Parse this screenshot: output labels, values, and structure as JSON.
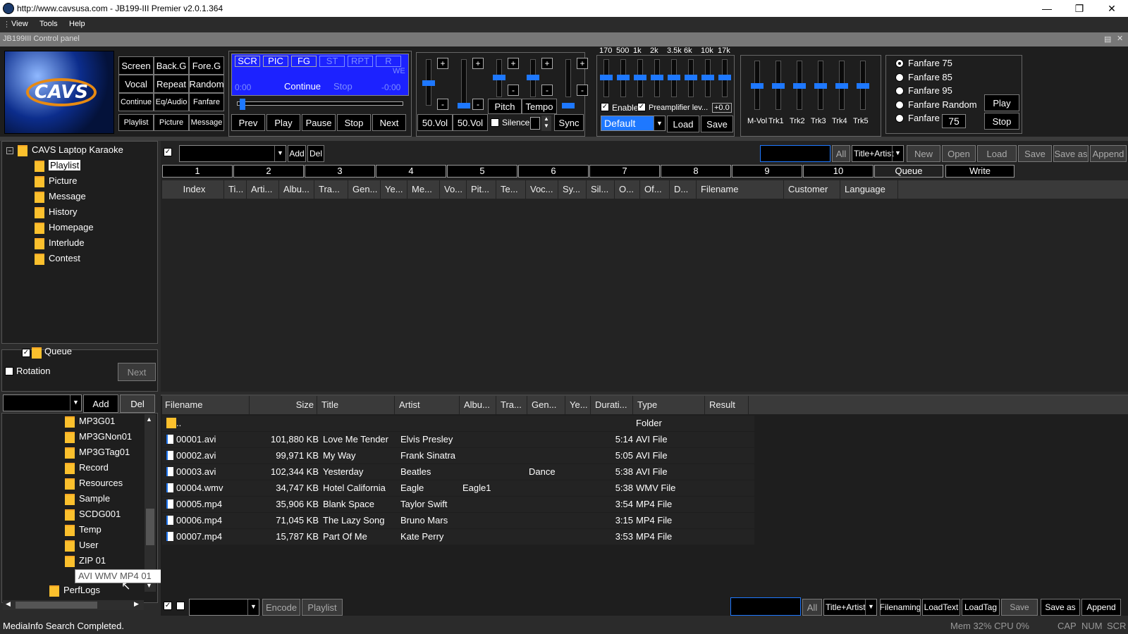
{
  "window": {
    "title": "http://www.cavsusa.com - JB199-III Premier v2.0.1.364"
  },
  "menu": {
    "view": "View",
    "tools": "Tools",
    "help": "Help"
  },
  "control_panel": {
    "title": "JB199III Control panel"
  },
  "logo": {
    "text": "CAVS"
  },
  "grid_buttons": [
    "Screen",
    "Back.G",
    "Fore.G",
    "Vocal",
    "Repeat",
    "Random",
    "Continue",
    "Eq/Audio",
    "Fanfare",
    "Playlist",
    "Picture",
    "Message"
  ],
  "player": {
    "tags": [
      "SCR",
      "PIC",
      "FG",
      "ST",
      "RPT",
      "R"
    ],
    "time_left": "0:00",
    "mode": "Continue",
    "stop_label": "Stop",
    "time_right": "-0:00",
    "we": "WE",
    "buttons": [
      "Prev",
      "Play",
      "Pause",
      "Stop",
      "Next"
    ]
  },
  "mixer": {
    "vol1": "50.Vol",
    "vol2": "50.Vol",
    "pitch": "Pitch",
    "tempo": "Tempo",
    "silence": "Silence",
    "sync": "Sync",
    "plus": "+",
    "minus": "-"
  },
  "eq": {
    "bands": [
      "170",
      "500",
      "1k",
      "2k",
      "3.5k",
      "6k",
      "10k",
      "17k"
    ],
    "enable": "Enable",
    "preamp": "Preamplifier lev...",
    "preamp_value": "+0.0",
    "preset": "Default",
    "load": "Load",
    "save": "Save"
  },
  "tracks": {
    "labels": [
      "M-Vol",
      "Trk1",
      "Trk2",
      "Trk3",
      "Trk4",
      "Trk5"
    ]
  },
  "fanfare": {
    "options": [
      "Fanfare 75",
      "Fanfare 85",
      "Fanfare 95",
      "Fanfare Random",
      "Fanfare"
    ],
    "value": "75",
    "play": "Play",
    "stop": "Stop"
  },
  "tree": {
    "root": "CAVS Laptop Karaoke",
    "items": [
      "Playlist",
      "Picture",
      "Message",
      "History",
      "Homepage",
      "Interlude",
      "Contest"
    ]
  },
  "queue": {
    "label": "Queue",
    "rotation": "Rotation",
    "next": "Next",
    "add": "Add",
    "del": "Del"
  },
  "folders": [
    "MP3G01",
    "MP3GNon01",
    "MP3GTag01",
    "Record",
    "Resources",
    "Sample",
    "SCDG001",
    "Temp",
    "User",
    "ZIP 01"
  ],
  "tooltip": "AVI WMV MP4 01",
  "perflogs": "PerfLogs",
  "playlist_toolbar": {
    "add": "Add",
    "del": "Del",
    "all": "All",
    "field": "Title+Artist",
    "new": "New",
    "open": "Open",
    "load": "Load",
    "save": "Save",
    "save_as": "Save as",
    "append": "Append"
  },
  "num_tabs": [
    "1",
    "2",
    "3",
    "4",
    "5",
    "6",
    "7",
    "8",
    "9",
    "10",
    "Queue",
    "Write"
  ],
  "playlist_columns": [
    "Index",
    "Ti...",
    "Arti...",
    "Albu...",
    "Tra...",
    "Gen...",
    "Ye...",
    "Me...",
    "Vo...",
    "Pit...",
    "Te...",
    "Voc...",
    "Sy...",
    "Sil...",
    "O...",
    "Of...",
    "D...",
    "Filename",
    "Customer",
    "Language"
  ],
  "file_columns": [
    "Filename",
    "Size",
    "Title",
    "Artist",
    "Albu...",
    "Tra...",
    "Gen...",
    "Ye...",
    "Durati...",
    "Type",
    "Result"
  ],
  "files": [
    {
      "name": "..",
      "size": "",
      "title": "",
      "artist": "",
      "album": "",
      "genre": "",
      "dur": "",
      "type": "Folder"
    },
    {
      "name": "00001.avi",
      "size": "101,880 KB",
      "title": "Love Me Tender",
      "artist": "Elvis Presley",
      "album": "",
      "genre": "",
      "dur": "5:14",
      "type": "AVI File"
    },
    {
      "name": "00002.avi",
      "size": "99,971 KB",
      "title": "My Way",
      "artist": "Frank Sinatra",
      "album": "",
      "genre": "",
      "dur": "5:05",
      "type": "AVI File"
    },
    {
      "name": "00003.avi",
      "size": "102,344 KB",
      "title": "Yesterday",
      "artist": "Beatles",
      "album": "",
      "genre": "Dance",
      "dur": "5:38",
      "type": "AVI File"
    },
    {
      "name": "00004.wmv",
      "size": "34,747 KB",
      "title": "Hotel California",
      "artist": "Eagle",
      "album": "Eagle1",
      "genre": "",
      "dur": "5:38",
      "type": "WMV File"
    },
    {
      "name": "00005.mp4",
      "size": "35,906 KB",
      "title": "Blank Space",
      "artist": "Taylor Swift",
      "album": "",
      "genre": "",
      "dur": "3:54",
      "type": "MP4 File"
    },
    {
      "name": "00006.mp4",
      "size": "71,045 KB",
      "title": "The Lazy Song",
      "artist": "Bruno Mars",
      "album": "",
      "genre": "",
      "dur": "3:15",
      "type": "MP4 File"
    },
    {
      "name": "00007.mp4",
      "size": "15,787 KB",
      "title": "Part Of Me",
      "artist": "Kate Perry",
      "album": "",
      "genre": "",
      "dur": "3:53",
      "type": "MP4 File"
    }
  ],
  "bottom_toolbar": {
    "encode": "Encode",
    "playlist": "Playlist",
    "all": "All",
    "field": "Title+Artist",
    "filenaming": "Filenaming",
    "loadtext": "LoadText",
    "loadtag": "LoadTag",
    "save": "Save",
    "save_as": "Save as",
    "append": "Append"
  },
  "status": {
    "message": "MediaInfo Search Completed.",
    "mem": "Mem 32% CPU  0%",
    "cap": "CAP",
    "num": "NUM",
    "scr": "SCR"
  }
}
